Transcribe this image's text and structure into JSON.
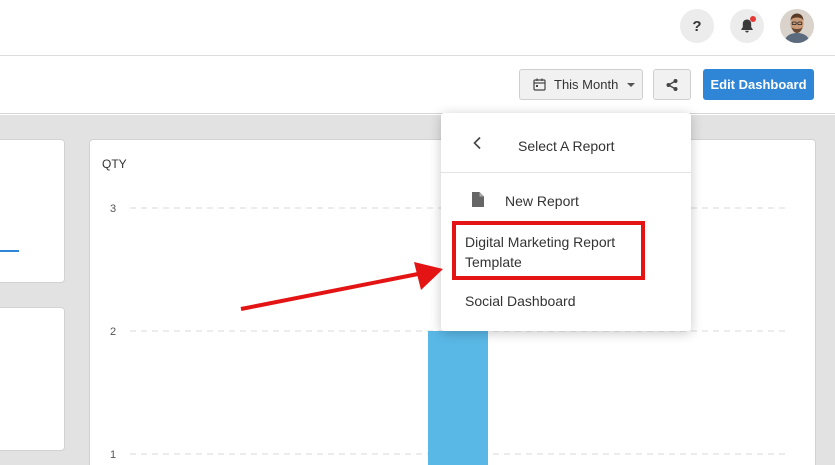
{
  "header": {
    "help_label": "?",
    "help_icon": "help-icon",
    "bell_icon": "bell-icon",
    "avatar_icon": "user-avatar"
  },
  "toolbar": {
    "range_label": "This Month",
    "calendar_icon": "calendar-icon",
    "share_icon": "share-icon",
    "edit_label": "Edit Dashboard"
  },
  "chart_data": {
    "type": "bar",
    "ylabel": "QTY",
    "yticks": [
      3,
      2,
      1
    ],
    "grid": true,
    "series": [
      {
        "values": [
          2
        ]
      }
    ]
  },
  "dropdown": {
    "title": "Select A Report",
    "back_icon": "chevron-left-icon",
    "items": [
      {
        "label": "New Report",
        "icon": "file-icon"
      },
      {
        "label": "Digital Marketing Report Template"
      },
      {
        "label": "Social Dashboard"
      }
    ]
  },
  "colors": {
    "accent": "#2f86d6",
    "bar": "#5ab8e6",
    "annotation": "#e41414"
  }
}
